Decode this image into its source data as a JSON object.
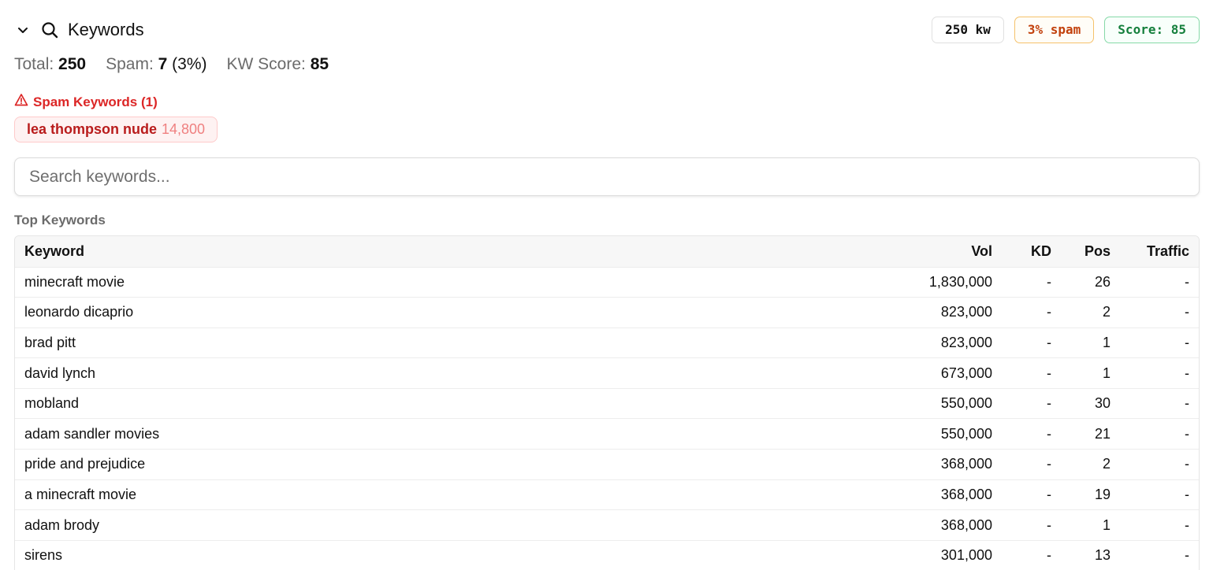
{
  "header": {
    "title": "Keywords",
    "badges": {
      "kw": "250 kw",
      "spam": "3% spam",
      "score": "Score: 85"
    }
  },
  "stats": {
    "total_label": "Total:",
    "total_value": "250",
    "spam_label": "Spam:",
    "spam_value": "7",
    "spam_pct": "(3%)",
    "kwscore_label": "KW Score:",
    "kwscore_value": "85"
  },
  "spam_keywords": {
    "title": "Spam Keywords (1)",
    "items": [
      {
        "keyword": "lea thompson nude",
        "volume": "14,800"
      }
    ]
  },
  "search": {
    "placeholder": "Search keywords..."
  },
  "top_keywords": {
    "label": "Top Keywords",
    "columns": [
      "Keyword",
      "Vol",
      "KD",
      "Pos",
      "Traffic"
    ],
    "rows": [
      [
        "minecraft movie",
        "1,830,000",
        "-",
        "26",
        "-"
      ],
      [
        "leonardo dicaprio",
        "823,000",
        "-",
        "2",
        "-"
      ],
      [
        "brad pitt",
        "823,000",
        "-",
        "1",
        "-"
      ],
      [
        "david lynch",
        "673,000",
        "-",
        "1",
        "-"
      ],
      [
        "mobland",
        "550,000",
        "-",
        "30",
        "-"
      ],
      [
        "adam sandler movies",
        "550,000",
        "-",
        "21",
        "-"
      ],
      [
        "pride and prejudice",
        "368,000",
        "-",
        "2",
        "-"
      ],
      [
        "a minecraft movie",
        "368,000",
        "-",
        "19",
        "-"
      ],
      [
        "adam brody",
        "368,000",
        "-",
        "1",
        "-"
      ],
      [
        "sirens",
        "301,000",
        "-",
        "13",
        "-"
      ]
    ]
  },
  "icons": [
    "chevron-down-icon",
    "search-icon",
    "warning-triangle-icon"
  ]
}
